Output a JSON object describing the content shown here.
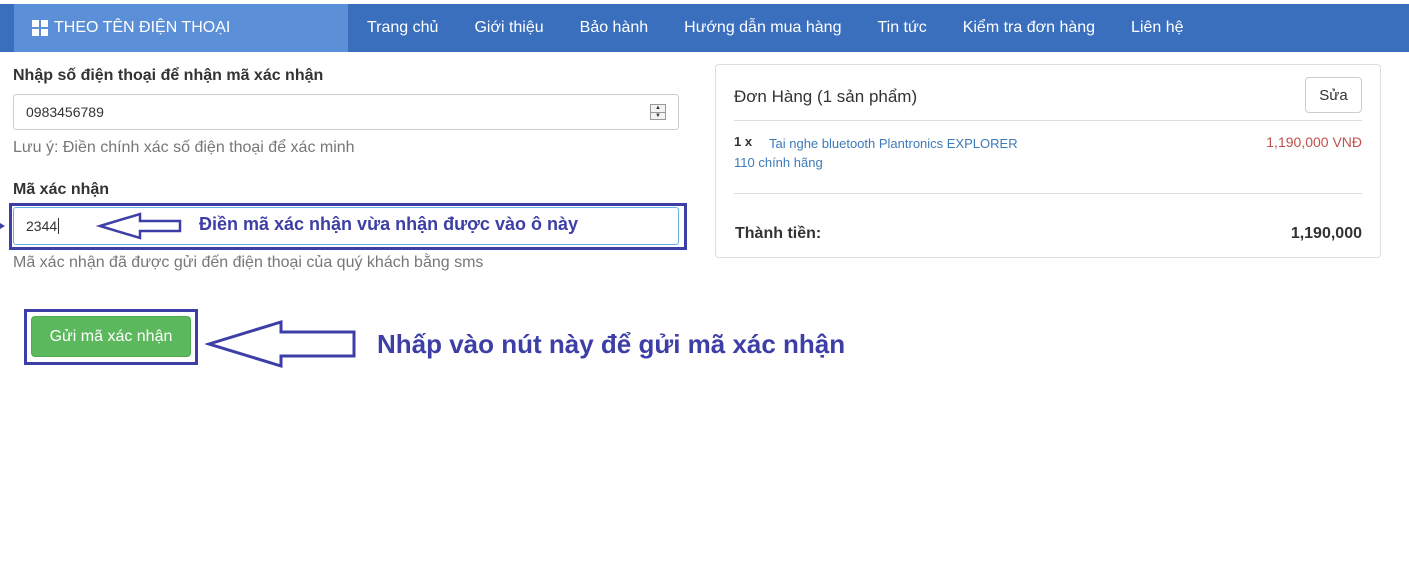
{
  "nav": {
    "brand": "THEO TÊN ĐIỆN THOẠI",
    "items": [
      "Trang chủ",
      "Giới thiệu",
      "Bảo hành",
      "Hướng dẫn mua hàng",
      "Tin tức",
      "Kiểm tra đơn hàng",
      "Liên hệ"
    ]
  },
  "form": {
    "phone_label": "Nhập số điện thoại để nhận mã xác nhận",
    "phone_value": "0983456789",
    "phone_note": "Lưu ý: Điền chính xác số điện thoại để xác minh",
    "code_label": "Mã xác nhận",
    "code_value": "2344",
    "code_note": "Mã xác nhận đã được gửi đến điện thoại của quý khách bằng sms",
    "submit_label": "Gửi mã xác nhận"
  },
  "annotations": {
    "code_hint": "Điền mã xác nhận vừa nhận được vào ô này",
    "button_hint": "Nhấp vào nút này để gửi mã xác nhận"
  },
  "order": {
    "title": "Đơn Hàng (1 sản phẩm)",
    "edit_label": "Sửa",
    "item_qty": "1 x",
    "item_name": "Tai nghe bluetooth Plantronics EXPLORER 110 chính hãng",
    "item_price": "1,190,000 VNĐ",
    "total_label": "Thành tiền:",
    "total_value": "1,190,000"
  },
  "colors": {
    "nav_bg": "#3a6fbe",
    "brand_bg": "#5b8fd7",
    "annotation": "#3d3fa6",
    "button_green": "#5cb85c",
    "price_red": "#c0504d",
    "link_blue": "#3d7ab8"
  }
}
